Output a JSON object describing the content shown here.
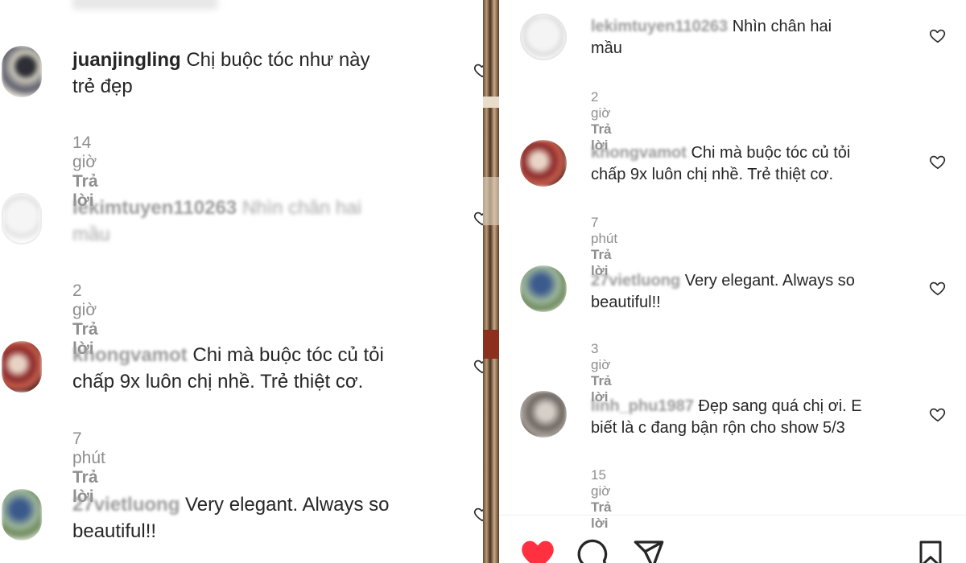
{
  "left": {
    "comments": [
      {
        "username": "juanjingling",
        "text": "Chị buộc tóc như này",
        "text2": "trẻ đẹp",
        "time": "14 giờ",
        "reply": "Trả lời"
      },
      {
        "username": "lekimtuyen110263",
        "text": "Nhìn chân hai",
        "text2": "mầu",
        "time": "2 giờ",
        "reply": "Trả lời"
      },
      {
        "username": "khongvamot",
        "text": "Chi mà buộc tóc củ tỏi",
        "text2": "chấp 9x luôn chị nhề. Trẻ thiệt cơ.",
        "time": "7 phút",
        "reply": "Trả lời"
      },
      {
        "username": "27vietluong",
        "text": "Very elegant. Always so",
        "text2": "beautiful!!",
        "time": "",
        "reply": ""
      }
    ]
  },
  "right": {
    "comments": [
      {
        "username": "lekimtuyen110263",
        "text": "Nhìn chân hai",
        "text2": "mầu",
        "time": "2 giờ",
        "reply": "Trả lời"
      },
      {
        "username": "khongvamot",
        "text": "Chi mà buộc tóc củ tỏi",
        "text2": "chấp 9x luôn chị nhề. Trẻ thiệt cơ.",
        "time": "7 phút",
        "reply": "Trả lời"
      },
      {
        "username": "27vietluong",
        "text": "Very elegant. Always so",
        "text2": "beautiful!!",
        "time": "3 giờ",
        "reply": "Trả lời"
      },
      {
        "username": "linh_phu1987",
        "text": "Đẹp sang quá chị ơi. E",
        "text2": "biết là c đang bận rộn cho show 5/3",
        "time": "15 giờ",
        "reply": "Trả lời"
      }
    ]
  },
  "icons": {
    "like": "heart-outline-icon",
    "liked": "heart-filled-icon",
    "comment": "comment-icon",
    "share": "send-icon",
    "save": "bookmark-icon"
  },
  "colors": {
    "liked_heart": "#ff3040",
    "meta": "#8e8e8e",
    "text": "#262626"
  }
}
